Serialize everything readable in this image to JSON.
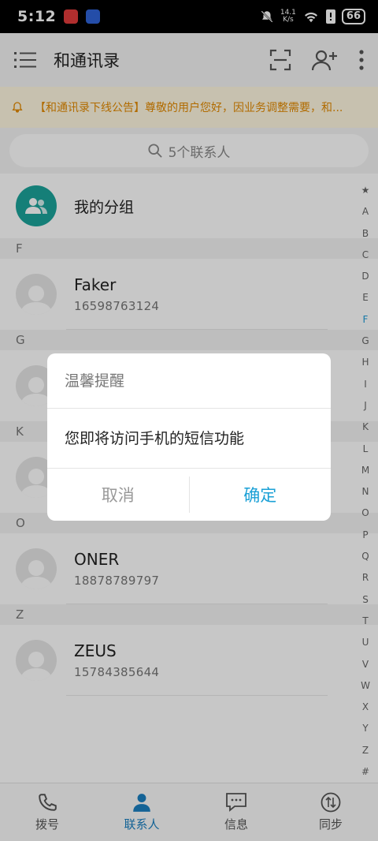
{
  "status": {
    "time": "5:12",
    "netspeed_value": "14.1",
    "netspeed_unit": "K/s",
    "battery": "66"
  },
  "appbar": {
    "title": "和通讯录"
  },
  "notice": {
    "text": "【和通讯录下线公告】尊敬的用户您好，因业务调整需要，和..."
  },
  "search": {
    "placeholder": "5个联系人"
  },
  "group": {
    "label": "我的分组"
  },
  "sections": [
    {
      "letter": "F",
      "contacts": [
        {
          "name": "Faker",
          "phone": "16598763124"
        }
      ]
    },
    {
      "letter": "G",
      "contacts": [
        {
          "name": "",
          "phone": ""
        }
      ]
    },
    {
      "letter": "K",
      "contacts": [
        {
          "name": "",
          "phone": ""
        }
      ]
    },
    {
      "letter": "O",
      "contacts": [
        {
          "name": "ONER",
          "phone": "18878789797"
        }
      ]
    },
    {
      "letter": "Z",
      "contacts": [
        {
          "name": "ZEUS",
          "phone": "15784385644"
        }
      ]
    }
  ],
  "index_letters": [
    "★",
    "A",
    "B",
    "C",
    "D",
    "E",
    "F",
    "G",
    "H",
    "I",
    "J",
    "K",
    "L",
    "M",
    "N",
    "O",
    "P",
    "Q",
    "R",
    "S",
    "T",
    "U",
    "V",
    "W",
    "X",
    "Y",
    "Z",
    "#"
  ],
  "index_active": "F",
  "tabs": [
    {
      "label": "拨号",
      "icon": "phone-icon"
    },
    {
      "label": "联系人",
      "icon": "person-icon"
    },
    {
      "label": "信息",
      "icon": "message-icon"
    },
    {
      "label": "同步",
      "icon": "sync-icon"
    }
  ],
  "dialog": {
    "title": "温馨提醒",
    "message": "您即将访问手机的短信功能",
    "cancel": "取消",
    "confirm": "确定"
  },
  "colors": {
    "accent": "#1aa0d6",
    "notice": "#e38a00",
    "group_avatar": "#1ba39a",
    "tab_active": "#1a7fc1"
  }
}
